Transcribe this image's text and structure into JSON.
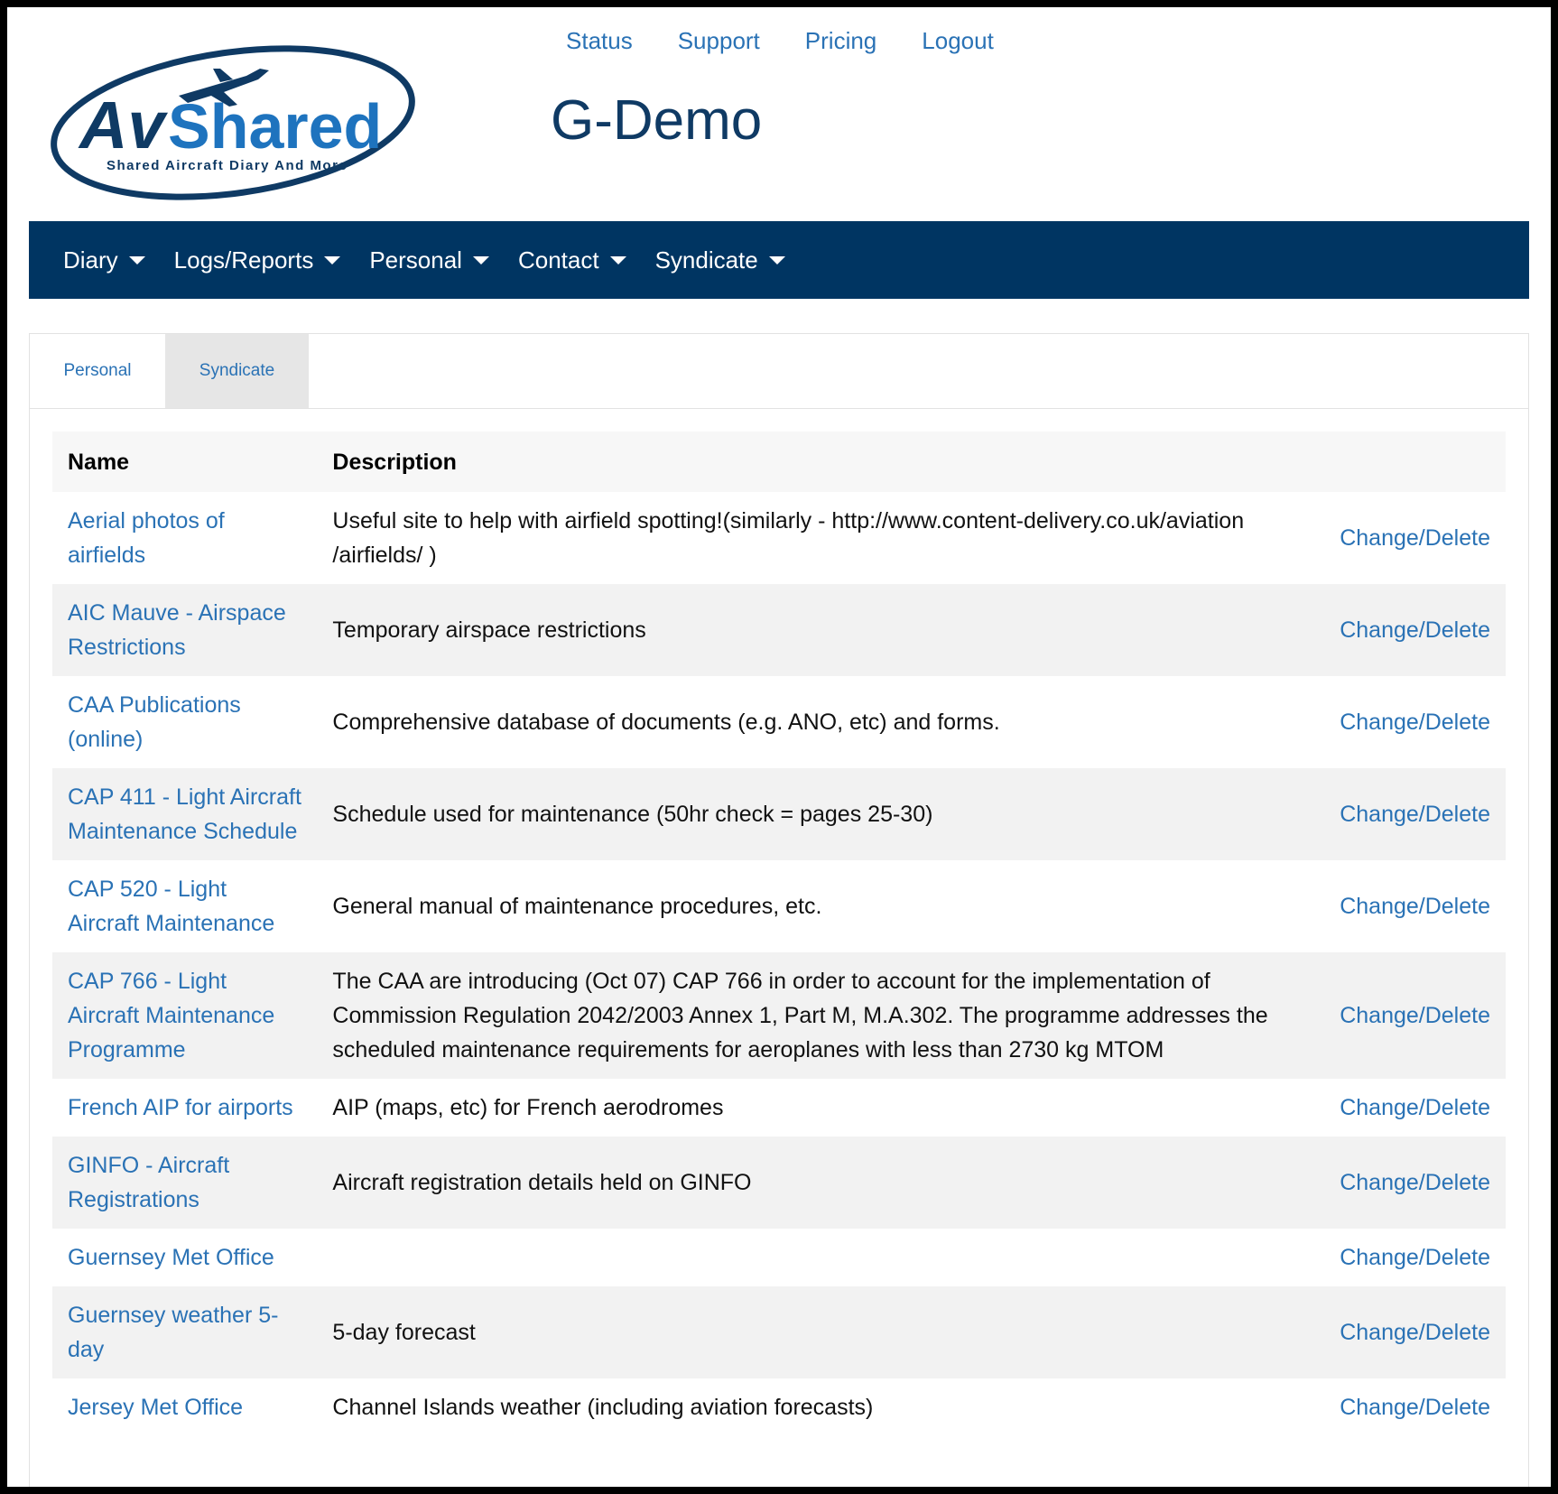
{
  "header": {
    "logo": {
      "wordmark": "AvShared",
      "tagline": "Shared Aircraft Diary And More",
      "colors": {
        "navy": "#0f3a64",
        "blue": "#1e73be"
      }
    },
    "top_links": [
      "Status",
      "Support",
      "Pricing",
      "Logout"
    ],
    "title": "G-Demo"
  },
  "navbar": {
    "background": "#003562",
    "items": [
      "Diary",
      "Logs/Reports",
      "Personal",
      "Contact",
      "Syndicate"
    ]
  },
  "tabs": [
    {
      "label": "Personal",
      "active": false
    },
    {
      "label": "Syndicate",
      "active": true
    }
  ],
  "table": {
    "headers": {
      "name": "Name",
      "description": "Description",
      "action": ""
    },
    "rows": [
      {
        "name": "Aerial photos of airfields",
        "description": "Useful site to help with airfield spotting!(similarly - http://www.content-delivery.co.uk/aviation /airfields/ )",
        "action": "Change/Delete"
      },
      {
        "name": "AIC Mauve - Airspace Restrictions",
        "description": "Temporary airspace restrictions",
        "action": "Change/Delete"
      },
      {
        "name": "CAA Publications (online)",
        "description": "Comprehensive database of documents (e.g. ANO, etc) and forms.",
        "action": "Change/Delete"
      },
      {
        "name": "CAP 411 - Light Aircraft Maintenance Schedule",
        "description": "Schedule used for maintenance (50hr check = pages 25-30)",
        "action": "Change/Delete"
      },
      {
        "name": "CAP 520 - Light Aircraft Maintenance",
        "description": "General manual of maintenance procedures, etc.",
        "action": "Change/Delete"
      },
      {
        "name": "CAP 766 - Light Aircraft Maintenance Programme",
        "description": "The CAA are introducing (Oct 07) CAP 766 in order to account for the implementation of Commission Regulation 2042/2003 Annex 1, Part M, M.A.302. The programme addresses the scheduled maintenance requirements for aeroplanes with less than 2730 kg MTOM",
        "action": "Change/Delete"
      },
      {
        "name": "French AIP for airports",
        "description": "AIP (maps, etc) for French aerodromes",
        "action": "Change/Delete"
      },
      {
        "name": "GINFO - Aircraft Registrations",
        "description": "Aircraft registration details held on GINFO",
        "action": "Change/Delete"
      },
      {
        "name": "Guernsey Met Office",
        "description": "",
        "action": "Change/Delete"
      },
      {
        "name": "Guernsey weather 5-day",
        "description": "5-day forecast",
        "action": "Change/Delete"
      },
      {
        "name": "Jersey Met Office",
        "description": "Channel Islands weather (including aviation forecasts)",
        "action": "Change/Delete"
      }
    ]
  }
}
